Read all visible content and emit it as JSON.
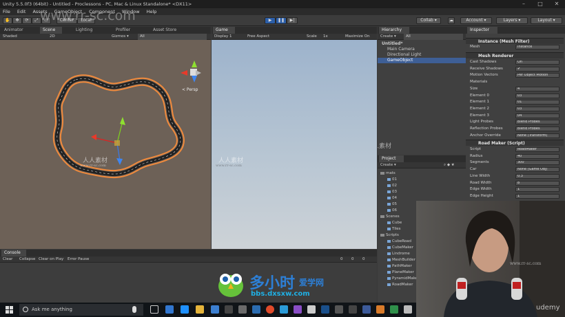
{
  "window": {
    "title": "Unity 5.5.0f3 (64bit) - Untitled - Proclessons - PC, Mac & Linux Standalone* <DX11>",
    "controls": [
      "–",
      "□",
      "✕"
    ]
  },
  "menu": [
    "File",
    "Edit",
    "Assets",
    "GameObject",
    "Component",
    "Window",
    "Help"
  ],
  "toolbar": {
    "tools": [
      "✋",
      "✥",
      "⟳",
      "⤢",
      "▭"
    ],
    "center_label": "Center",
    "local_label": "Local",
    "play": "▶",
    "pause": "❚❚",
    "step": "▶|",
    "collab": "Collab ▾",
    "account": "Account ▾",
    "layers": "Layers ▾",
    "layout": "Layout ▾"
  },
  "scene_panel": {
    "tabs": [
      "Animator",
      "Scene",
      "Lighting",
      "Profiler",
      "Asset Store"
    ],
    "shading": "Shaded",
    "mode": "2D",
    "gizmos": "Gizmos ▾",
    "search": "All",
    "persp_label": "< Persp"
  },
  "game_panel": {
    "tab": "Game",
    "display": "Display 1",
    "aspect": "Free Aspect",
    "scale": "Scale",
    "scale_value": "1x",
    "maximize": "Maximize On Play"
  },
  "hierarchy": {
    "tab": "Hierarchy",
    "create": "Create ▾",
    "search": "All",
    "scene": "Untitled*",
    "items": [
      "Main Camera",
      "Directional Light",
      "GameObject"
    ],
    "selected_index": 2
  },
  "project": {
    "tab": "Project",
    "create": "Create ▾",
    "folders": [
      {
        "name": "mats",
        "children": [
          "01",
          "02",
          "03",
          "04",
          "05",
          "06"
        ]
      },
      {
        "name": "Scenes",
        "children": [
          "Cube",
          "Tiles"
        ]
      },
      {
        "name": "Scripts",
        "children": [
          "CubeRoad",
          "CubeMaker",
          "Lindrome",
          "MeshBuilder",
          "PathMaker",
          "PlaneMaker",
          "PyramidMaker",
          "RoadMaker"
        ]
      }
    ]
  },
  "inspector": {
    "tab": "Inspector",
    "mesh_filter": {
      "header": "Instance (Mesh Filter)",
      "mesh_label": "Mesh",
      "mesh_value": "Instance"
    },
    "mesh_renderer": {
      "header": "Mesh Renderer",
      "rows": [
        {
          "label": "Cast Shadows",
          "value": "On"
        },
        {
          "label": "Receive Shadows",
          "value": "✔"
        },
        {
          "label": "Motion Vectors",
          "value": "Per Object Motion"
        },
        {
          "label": "Materials",
          "value": ""
        },
        {
          "label": "Size",
          "value": "4"
        },
        {
          "label": "Element 0",
          "value": "03"
        },
        {
          "label": "Element 1",
          "value": "01"
        },
        {
          "label": "Element 2",
          "value": "03"
        },
        {
          "label": "Element 3",
          "value": "04"
        },
        {
          "label": "Light Probes",
          "value": "Blend Probes"
        },
        {
          "label": "Reflection Probes",
          "value": "Blend Probes"
        },
        {
          "label": "Anchor Override",
          "value": "None (Transform)"
        }
      ]
    },
    "road_maker": {
      "header": "Road Maker (Script)",
      "rows": [
        {
          "label": "Script",
          "value": "RoadMaker"
        },
        {
          "label": "Radius",
          "value": "40"
        },
        {
          "label": "Segments",
          "value": "300"
        },
        {
          "label": "Car",
          "value": "None (Game Obj)"
        },
        {
          "label": "Line Width",
          "value": "0.3"
        },
        {
          "label": "Road Width",
          "value": "8"
        },
        {
          "label": "Edge Width",
          "value": "1"
        },
        {
          "label": "Edge Height",
          "value": "1"
        }
      ]
    }
  },
  "console": {
    "tab": "Console",
    "buttons": [
      "Clear",
      "Collapse",
      "Clear on Play",
      "Error Pause"
    ],
    "counts": [
      "0",
      "0",
      "0"
    ]
  },
  "taskbar": {
    "search_placeholder": "Ask me anything"
  },
  "watermarks": {
    "site_top": "www.rr-sc.com",
    "cn_mid": "人人素材",
    "cn_mid_url": "www.rr-sc.com",
    "logo_cn": "多小时",
    "logo_cn2": "爱学网",
    "logo_url": "bbs.dxsxw.com",
    "udemy": "udemy",
    "webcam_url": "www.rr-sc.com"
  },
  "colors": {
    "unity_dark": "#383838",
    "selection": "#3e5f96",
    "road_orange": "#e8782b",
    "scene_bg": "#6d6157"
  }
}
